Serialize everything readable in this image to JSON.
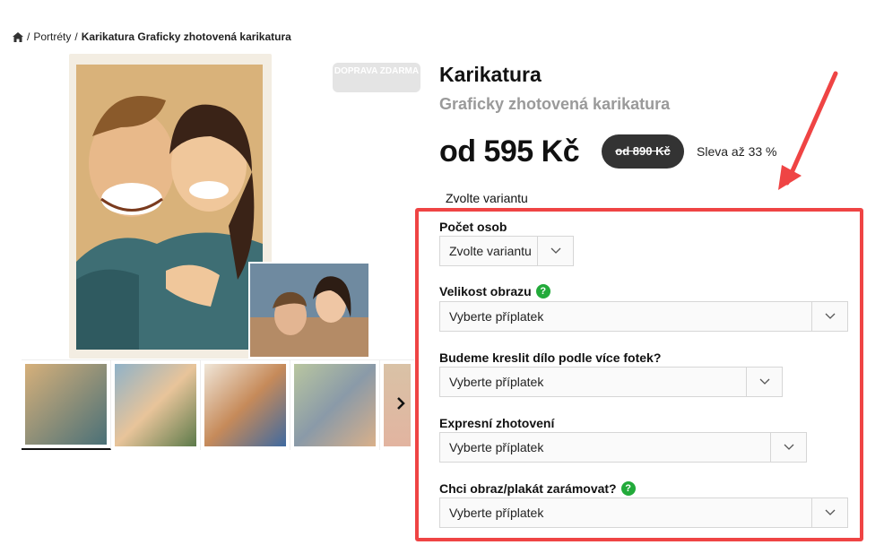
{
  "breadcrumb": {
    "items": [
      "Portréty",
      "Karikatura Graficky zhotovená karikatura"
    ],
    "separator": "/"
  },
  "gallery": {
    "badge": "DOPRAVA ZDARMA",
    "next_icon": "chevron-right-icon"
  },
  "product": {
    "title": "Karikatura",
    "subtitle": "Graficky zhotovená karikatura",
    "price": "od 595 Kč",
    "old_price": "od 890 Kč",
    "discount": "Sleva až 33 %",
    "choose_variant_label": "Zvolte variantu"
  },
  "options": [
    {
      "label": "Počet osob",
      "value": "Zvolte variantu",
      "help": false
    },
    {
      "label": "Velikost obrazu",
      "value": "Vyberte příplatek",
      "help": true
    },
    {
      "label": "Budeme kreslit dílo podle více fotek?",
      "value": "Vyberte příplatek",
      "help": false
    },
    {
      "label": "Expresní zhotovení",
      "value": "Vyberte příplatek",
      "help": false
    },
    {
      "label": "Chci obraz/plakát zarámovat?",
      "value": "Vyberte příplatek",
      "help": true
    }
  ],
  "help_glyph": "?",
  "colors": {
    "highlight": "#ef4444",
    "help": "#22aa3a",
    "old_price_bg": "#333333",
    "subtitle": "#9a9a9a"
  }
}
